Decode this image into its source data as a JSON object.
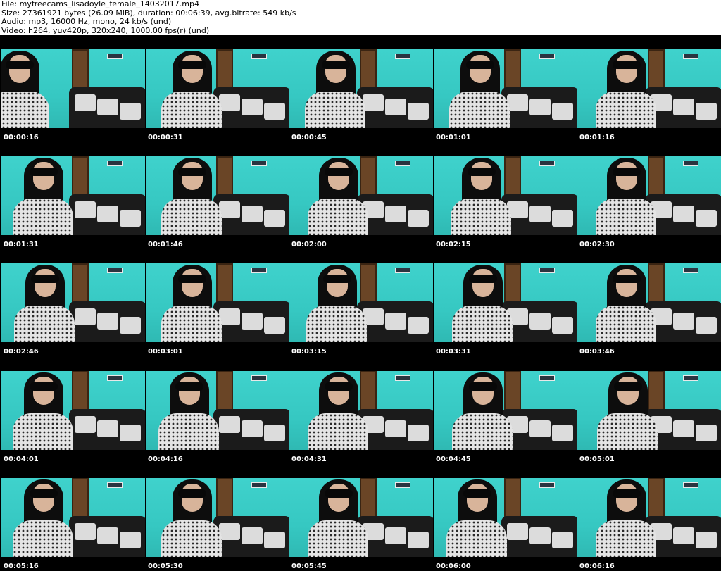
{
  "header": {
    "file": "File: myfreecams_lisadoyle_female_14032017.mp4",
    "size": "Size: 27361921 bytes (26.09 MiB), duration: 00:06:39, avg.bitrate: 549 kb/s",
    "audio": "Audio: mp3, 16000 Hz, mono, 24 kb/s (und)",
    "video": "Video: h264, yuv420p, 320x240, 1000.00 fps(r) (und)"
  },
  "thumbnails": [
    {
      "time": "00:00:16"
    },
    {
      "time": "00:00:31"
    },
    {
      "time": "00:00:45"
    },
    {
      "time": "00:01:01"
    },
    {
      "time": "00:01:16"
    },
    {
      "time": "00:01:31"
    },
    {
      "time": "00:01:46"
    },
    {
      "time": "00:02:00"
    },
    {
      "time": "00:02:15"
    },
    {
      "time": "00:02:30"
    },
    {
      "time": "00:02:46"
    },
    {
      "time": "00:03:01"
    },
    {
      "time": "00:03:15"
    },
    {
      "time": "00:03:31"
    },
    {
      "time": "00:03:46"
    },
    {
      "time": "00:04:01"
    },
    {
      "time": "00:04:16"
    },
    {
      "time": "00:04:31"
    },
    {
      "time": "00:04:45"
    },
    {
      "time": "00:05:01"
    },
    {
      "time": "00:05:16"
    },
    {
      "time": "00:05:30"
    },
    {
      "time": "00:05:45"
    },
    {
      "time": "00:06:00"
    },
    {
      "time": "00:06:16"
    }
  ],
  "colors": {
    "wall": "#3fd2cc",
    "background": "#000000",
    "timestamp": "#ffffff"
  }
}
